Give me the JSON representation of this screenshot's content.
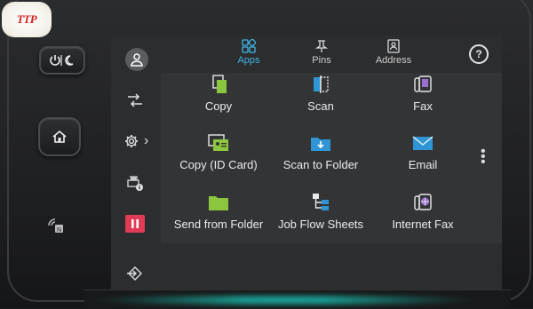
{
  "logo": {
    "text": "TTP"
  },
  "colors": {
    "accent": "#3fb6e8",
    "stop": "#e23b55",
    "folder": "#8cc63f",
    "icon_blue": "#2f95d4"
  },
  "hardware": {
    "power_icon": "power-sleep-icon",
    "home_icon": "home-icon",
    "nfc_icon": "nfc-icon"
  },
  "tabs": [
    {
      "label": "Apps",
      "icon": "apps-grid-icon",
      "active": true
    },
    {
      "label": "Pins",
      "icon": "pin-icon",
      "active": false
    },
    {
      "label": "Address",
      "icon": "address-book-icon",
      "active": false
    }
  ],
  "help_label": "?",
  "sidebar": [
    {
      "icon": "user-icon"
    },
    {
      "icon": "job-status-icon"
    },
    {
      "icon": "settings-icon",
      "chevron": "›"
    },
    {
      "icon": "printer-info-icon"
    },
    {
      "icon": "stop-icon"
    },
    {
      "icon": "sign-in-icon"
    }
  ],
  "apps": [
    {
      "label": "Copy",
      "icon": "copy-icon"
    },
    {
      "label": "Scan",
      "icon": "scan-icon"
    },
    {
      "label": "Fax",
      "icon": "fax-icon"
    },
    {
      "label": "Copy (ID Card)",
      "icon": "id-card-icon"
    },
    {
      "label": "Scan to Folder",
      "icon": "scan-to-folder-icon"
    },
    {
      "label": "Email",
      "icon": "email-icon"
    },
    {
      "label": "Send from Folder",
      "icon": "folder-icon"
    },
    {
      "label": "Job Flow Sheets",
      "icon": "job-flow-icon"
    },
    {
      "label": "Internet Fax",
      "icon": "internet-fax-icon"
    }
  ],
  "more_icon": "more-vertical-icon"
}
